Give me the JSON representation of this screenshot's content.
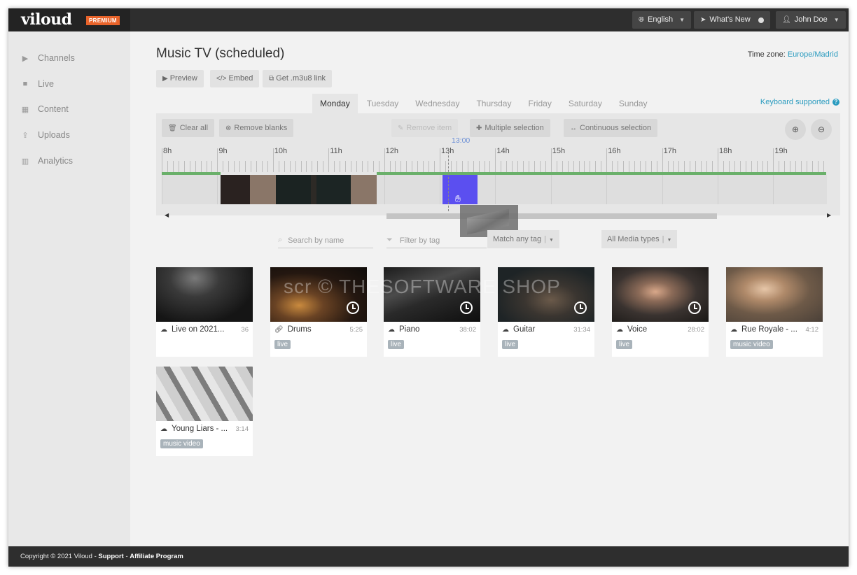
{
  "topbar": {
    "logo": "viloud",
    "badge": "PREMIUM",
    "language": "English",
    "whats_new": "What's New",
    "user": "John Doe"
  },
  "sidebar": {
    "items": [
      {
        "label": "Channels",
        "icon": "play-icon"
      },
      {
        "label": "Live",
        "icon": "video-camera-icon"
      },
      {
        "label": "Content",
        "icon": "grid-icon"
      },
      {
        "label": "Uploads",
        "icon": "upload-icon"
      },
      {
        "label": "Analytics",
        "icon": "bar-chart-icon"
      }
    ]
  },
  "page": {
    "title": "Music TV (scheduled)",
    "timezone_label": "Time zone:",
    "timezone_value": "Europe/Madrid",
    "actions": [
      "Preview",
      "Embed",
      "Get .m3u8 link"
    ]
  },
  "schedule": {
    "days": [
      "Monday",
      "Tuesday",
      "Wednesday",
      "Thursday",
      "Friday",
      "Saturday",
      "Sunday"
    ],
    "active_day": "Monday",
    "keyboard_hint": "Keyboard supported",
    "toolbar": {
      "clear_all": "Clear all",
      "remove_blanks": "Remove blanks",
      "remove_item": "Remove item",
      "multiple_selection": "Multiple selection",
      "continuous_selection": "Continuous selection"
    },
    "hours": [
      "8h",
      "9h",
      "10h",
      "11h",
      "12h",
      "13h",
      "14h",
      "15h",
      "16h",
      "17h",
      "18h",
      "19h"
    ],
    "current_time": "13:00"
  },
  "filters": {
    "search_placeholder": "Search by name",
    "tag_placeholder": "Filter by tag",
    "match_mode": "Match any tag",
    "media_type": "All Media types"
  },
  "media": [
    {
      "name": "Live on 2021...",
      "duration": "36",
      "tag": "",
      "scheduled": false,
      "icon": "cloud-icon"
    },
    {
      "name": "Drums",
      "duration": "5:25",
      "tag": "live",
      "scheduled": true,
      "icon": "link-icon"
    },
    {
      "name": "Piano",
      "duration": "38:02",
      "tag": "live",
      "scheduled": true,
      "icon": "cloud-icon"
    },
    {
      "name": "Guitar",
      "duration": "31:34",
      "tag": "live",
      "scheduled": true,
      "icon": "cloud-icon"
    },
    {
      "name": "Voice",
      "duration": "28:02",
      "tag": "live",
      "scheduled": true,
      "icon": "cloud-icon"
    },
    {
      "name": "Rue Royale - ...",
      "duration": "4:12",
      "tag": "music video",
      "scheduled": false,
      "icon": "cloud-icon"
    },
    {
      "name": "Young Liars - ...",
      "duration": "3:14",
      "tag": "music video",
      "scheduled": false,
      "icon": "cloud-icon"
    }
  ],
  "watermark": "scr © THESOFTWARE SHOP",
  "footer": {
    "copyright": "Copyright © 2021 Viloud - ",
    "support": "Support",
    "separator": " - ",
    "affiliate": "Affiliate Program"
  },
  "colors": {
    "accent": "#2a9bbf",
    "premium": "#e8632a",
    "selected_block": "#5b4ff0",
    "timeline_green": "#6ab06a"
  }
}
